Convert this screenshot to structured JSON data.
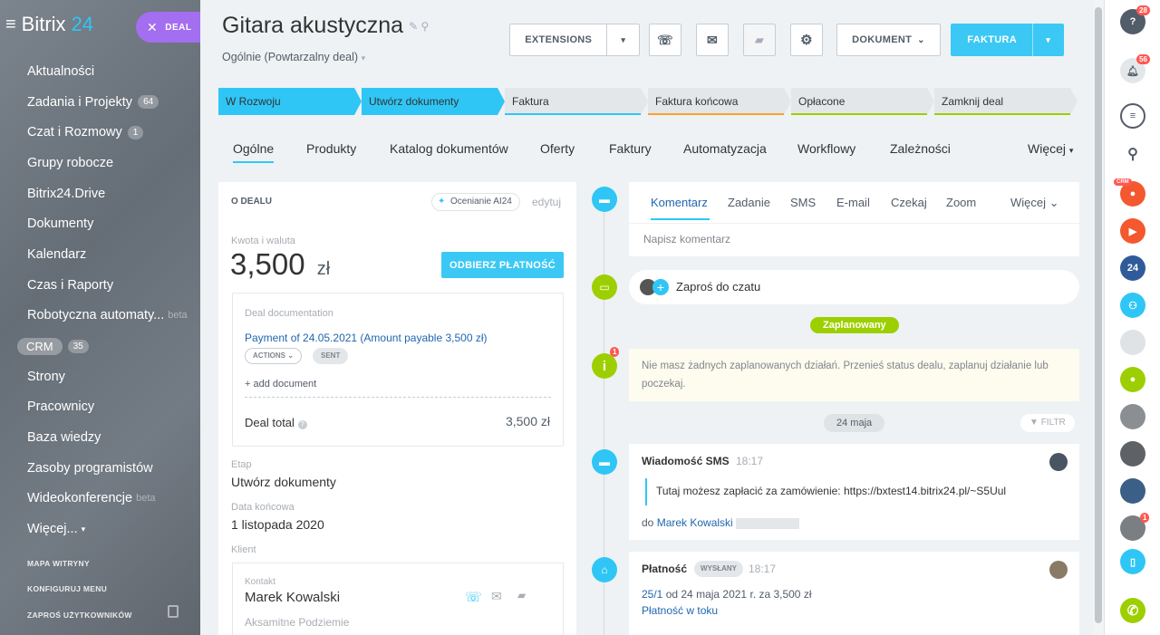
{
  "sidebar": {
    "logo_a": "Bitrix",
    "logo_b": "24",
    "deal_pill": "DEAL",
    "items": [
      {
        "label": "Aktualności",
        "count": ""
      },
      {
        "label": "Zadania i Projekty",
        "count": "64"
      },
      {
        "label": "Czat i Rozmowy",
        "count": "1"
      },
      {
        "label": "Grupy robocze",
        "count": ""
      },
      {
        "label": "Bitrix24.Drive",
        "count": ""
      },
      {
        "label": "Dokumenty",
        "count": ""
      },
      {
        "label": "Kalendarz",
        "count": ""
      },
      {
        "label": "Czas i Raporty",
        "count": ""
      },
      {
        "label": "Robotyczna automaty...",
        "beta": "beta"
      },
      {
        "label": "CRM",
        "count": "35"
      },
      {
        "label": "Strony",
        "count": ""
      },
      {
        "label": "Pracownicy",
        "count": ""
      },
      {
        "label": "Baza wiedzy",
        "count": ""
      },
      {
        "label": "Zasoby programistów",
        "count": ""
      },
      {
        "label": "Wideokonferencje",
        "beta": "beta"
      },
      {
        "label": "Więcej...",
        "count": ""
      }
    ],
    "sitemap": "MAPA WITRYNY",
    "configure": "KONFIGURUJ MENU",
    "invite": "ZAPROŚ UŻYTKOWNIKÓW"
  },
  "header": {
    "title": "Gitara akustyczna",
    "subtitle": "Ogólnie (Powtarzalny deal)",
    "extensions": "EXTENSIONS",
    "dokument": "DOKUMENT",
    "faktura": "FAKTURA"
  },
  "stages": [
    {
      "label": "W Rozwoju",
      "color": "#2fc6f6"
    },
    {
      "label": "Utwórz dokumenty",
      "color": "#2fc6f6"
    },
    {
      "label": "Faktura",
      "color": "#e4e7ea"
    },
    {
      "label": "Faktura końcowa",
      "color": "#e4e7ea"
    },
    {
      "label": "Opłacone",
      "color": "#e4e7ea"
    },
    {
      "label": "Zamknij deal",
      "color": "#e4e7ea"
    }
  ],
  "tabs": [
    "Ogólne",
    "Produkty",
    "Katalog dokumentów",
    "Oferty",
    "Faktury",
    "Automatyzacja",
    "Workflowy",
    "Zależności",
    "Więcej"
  ],
  "deal": {
    "section_title": "O DEALU",
    "ai_label": "Ocenianie AI24",
    "edit": "edytuj",
    "amount_label": "Kwota i waluta",
    "amount": "3,500",
    "currency": "zł",
    "pay_button": "ODBIERZ PŁATNOŚĆ",
    "doc_title": "Deal documentation",
    "payment_link": "Payment of 24.05.2021 (Amount payable 3,500 zł)",
    "actions": "ACTIONS",
    "sent": "SENT",
    "add_document": "+ add document",
    "total_label": "Deal total",
    "total_value": "3,500 zł",
    "stage_label": "Etap",
    "stage_value": "Utwórz dokumenty",
    "end_label": "Data końcowa",
    "end_value": "1 listopada 2020",
    "client_label": "Klient",
    "contact_label": "Kontakt",
    "contact_name": "Marek Kowalski",
    "company": "Aksamitne Podziemie"
  },
  "timeline": {
    "tabs": [
      "Komentarz",
      "Zadanie",
      "SMS",
      "E-mail",
      "Czekaj",
      "Zoom",
      "Więcej"
    ],
    "comment_placeholder": "Napisz komentarz",
    "invite_chat": "Zaproś do czatu",
    "planned": "Zaplanowany",
    "no_actions": "Nie masz żadnych zaplanowanych działań. Przenieś status dealu, zaplanuj działanie lub poczekaj.",
    "date_pill": "24 maja",
    "filter": "FILTR",
    "sms_title": "Wiadomość SMS",
    "sms_time": "18:17",
    "sms_text": "Tutaj możesz zapłacić za zamówienie: https://bxtest14.bitrix24.pl/~S5Uul",
    "sms_to_prefix": "do",
    "sms_to": "Marek Kowalski",
    "pay_title": "Płatność",
    "pay_badge": "WYSŁANY",
    "pay_time": "18:17",
    "pay_link": "25/1",
    "pay_text": "od 24 maja 2021 r. za 3,500 zł",
    "pay_status": "Płatność w toku"
  },
  "rightbar": {
    "help_badge": "28",
    "bell_badge": "56",
    "crm_badge": "CRM",
    "b24": "24",
    "avatar_badge": "1"
  }
}
